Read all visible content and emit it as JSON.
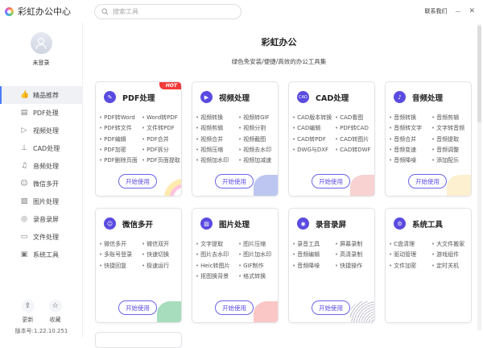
{
  "app": {
    "title": "彩虹办公中心",
    "search_placeholder": "搜索工具",
    "contact": "联系我们",
    "minimize": "—",
    "close": "✕"
  },
  "user": {
    "status": "未登录"
  },
  "sidebar": {
    "items": [
      {
        "label": "精品推荐",
        "icon": "👍"
      },
      {
        "label": "PDF处理",
        "icon": "▤"
      },
      {
        "label": "视频处理",
        "icon": "▷"
      },
      {
        "label": "CAD处理",
        "icon": "⊥"
      },
      {
        "label": "音频处理",
        "icon": "♫"
      },
      {
        "label": "微信多开",
        "icon": "☺"
      },
      {
        "label": "图片处理",
        "icon": "▨"
      },
      {
        "label": "录音录屏",
        "icon": "◎"
      },
      {
        "label": "文件处理",
        "icon": "▭"
      },
      {
        "label": "系统工具",
        "icon": "▣"
      }
    ],
    "update": "更新",
    "favorite": "收藏",
    "version": "版本号:1.22.10.251"
  },
  "main": {
    "title": "彩虹办公",
    "subtitle": "绿色免安装/便捷/高效的办公工具集",
    "start_label": "开始使用",
    "hot": "HOT"
  },
  "cards": [
    {
      "title": "PDF处理",
      "icon": "✎",
      "items": [
        "PDF转Word",
        "Word转PDF",
        "PDF转文件",
        "文件转PDF",
        "PDF编辑",
        "PDF合并",
        "PDF加密",
        "PDF拆分",
        "PDF删除页面",
        "PDF页面提取"
      ]
    },
    {
      "title": "视频处理",
      "icon": "▶",
      "items": [
        "视频转换",
        "视频转GIF",
        "视频剪辑",
        "视频分割",
        "视频合并",
        "视频截图",
        "视频压缩",
        "视频去水印",
        "视频加水印",
        "视频加减速"
      ]
    },
    {
      "title": "CAD处理",
      "icon": "CAD",
      "items": [
        "CAD版本转换",
        "CAD看图",
        "CAD编辑",
        "PDF转CAD",
        "CAD转PDF",
        "CAD转图片",
        "DWG与DXF",
        "CAD转DWF"
      ]
    },
    {
      "title": "音频处理",
      "icon": "♪",
      "items": [
        "音频转换",
        "音频剪辑",
        "音频转文字",
        "文字转音频",
        "音频合并",
        "音频提取",
        "音频变速",
        "音频调整",
        "音频降噪",
        "添加配乐"
      ]
    },
    {
      "title": "微信多开",
      "icon": "☺",
      "items": [
        "微信多开",
        "微信双开",
        "多账号登录",
        "快速切换",
        "快捷回复",
        "极速运行"
      ]
    },
    {
      "title": "图片处理",
      "icon": "▨",
      "items": [
        "文字提取",
        "图片压缩",
        "图片去水印",
        "图片加水印",
        "Heic转图片",
        "GIF制作",
        "抠图换背景",
        "格式转换"
      ]
    },
    {
      "title": "录音录屏",
      "icon": "◉",
      "items": [
        "录音工具",
        "屏幕录制",
        "音频编辑",
        "高清录制",
        "音频降噪",
        "快捷操作"
      ]
    },
    {
      "title": "系统工具",
      "icon": "⚙",
      "items": [
        "C盘清理",
        "大文件搬家",
        "驱动管理",
        "游戏组件",
        "文件加密",
        "定时关机"
      ]
    }
  ]
}
